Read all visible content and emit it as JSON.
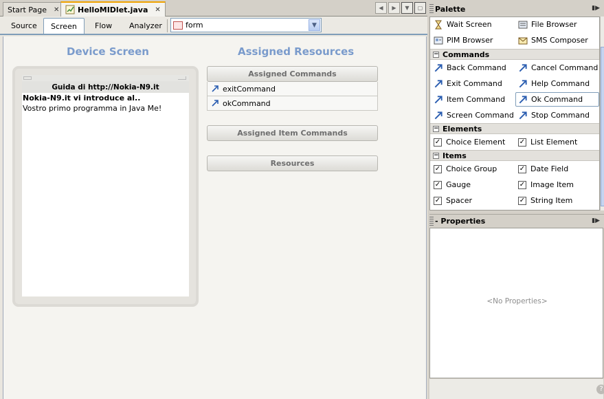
{
  "tabs": [
    {
      "label": "Start Page",
      "active": false
    },
    {
      "label": "HelloMIDlet.java",
      "active": true
    }
  ],
  "toolbar": {
    "views": [
      "Source",
      "Screen",
      "Flow",
      "Analyzer"
    ],
    "selected_view": "Screen",
    "screen_combo": {
      "value": "form"
    }
  },
  "device_screen": {
    "heading": "Device Screen",
    "title": "Guida di http://Nokia-N9.it",
    "line1": "Nokia-N9.it vi introduce al..",
    "line2": "Vostro primo programma in Java Me!"
  },
  "assigned": {
    "heading": "Assigned Resources",
    "commands_header": "Assigned Commands",
    "commands": [
      "exitCommand",
      "okCommand"
    ],
    "item_commands_header": "Assigned Item Commands",
    "resources_header": "Resources"
  },
  "palette": {
    "title": "Palette",
    "top_items": [
      {
        "label": "Wait Screen",
        "icon": "hourglass-icon"
      },
      {
        "label": "File Browser",
        "icon": "file-browser-icon"
      },
      {
        "label": "PIM Browser",
        "icon": "pim-browser-icon"
      },
      {
        "label": "SMS Composer",
        "icon": "sms-composer-icon"
      }
    ],
    "categories": [
      {
        "name": "Commands",
        "items": [
          "Back Command",
          "Cancel Command",
          "Exit Command",
          "Help Command",
          "Item Command",
          "Ok Command",
          "Screen Command",
          "Stop Command"
        ],
        "selected": "Ok Command"
      },
      {
        "name": "Elements",
        "items": [
          "Choice Element",
          "List Element"
        ]
      },
      {
        "name": "Items",
        "items": [
          "Choice Group",
          "Date Field",
          "Gauge",
          "Image Item",
          "Spacer",
          "String Item"
        ]
      }
    ]
  },
  "properties": {
    "title": "- Properties",
    "empty_text": "<No Properties>"
  },
  "colors": {
    "heading_blue": "#7a9bcc",
    "active_tab_accent": "#f0a300",
    "selection_border": "#7f9db9"
  }
}
